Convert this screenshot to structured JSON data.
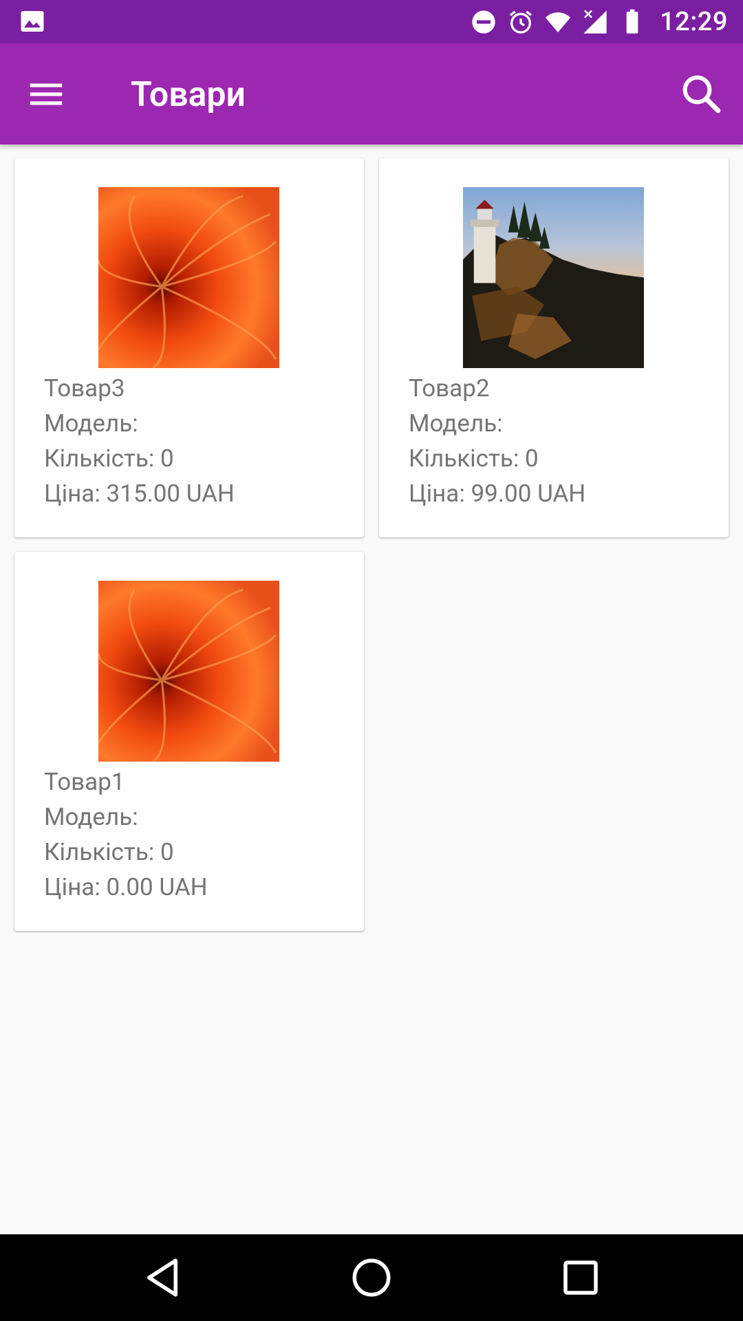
{
  "status_bar": {
    "time": "12:29",
    "icons": [
      "image-icon",
      "do-not-disturb-icon",
      "alarm-icon",
      "wifi-icon",
      "signal-icon",
      "battery-icon"
    ]
  },
  "app_bar": {
    "title": "Товари",
    "menu_icon": "menu-icon",
    "search_icon": "search-icon"
  },
  "products": [
    {
      "name": "Товар3",
      "model": "Модель:",
      "quantity": "Кількість: 0",
      "price": "Ціна: 315.00 UAH",
      "image": "flower"
    },
    {
      "name": "Товар2",
      "model": "Модель:",
      "quantity": "Кількість: 0",
      "price": "Ціна: 99.00 UAH",
      "image": "lighthouse"
    },
    {
      "name": "Товар1",
      "model": "Модель:",
      "quantity": "Кількість: 0",
      "price": "Ціна: 0.00 UAH",
      "image": "flower"
    }
  ],
  "nav_bar": {
    "icons": [
      "back-icon",
      "home-icon",
      "recents-icon"
    ]
  },
  "colors": {
    "status_bar": "#7b1fa2",
    "app_bar": "#9c27b0",
    "background": "#f9f9f9",
    "card": "#ffffff",
    "text_secondary": "#757575"
  }
}
